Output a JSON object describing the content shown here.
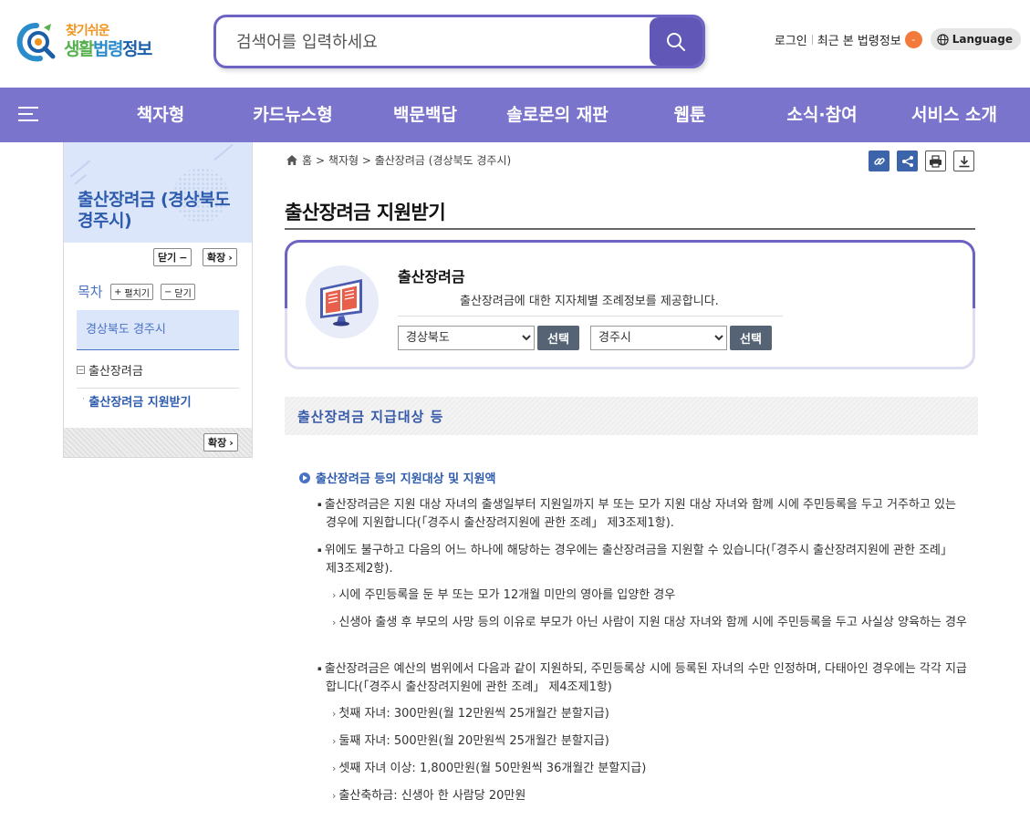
{
  "header": {
    "logo": {
      "top": "찾기쉬운",
      "main_g": "생활",
      "main_b": "법령",
      "main_d": "정보"
    },
    "search": {
      "placeholder": "검색어를 입력하세요"
    },
    "util": {
      "login": "로그인",
      "recent": "최근 본 법령정보",
      "recent_count": "-",
      "language": "Language"
    }
  },
  "nav": {
    "items": [
      "책자형",
      "카드뉴스형",
      "백문백답",
      "솔로몬의 재판",
      "웹툰",
      "소식·참여",
      "서비스 소개"
    ]
  },
  "sidebar": {
    "title": "출산장려금 (경상북도 경주시)",
    "close_label": "닫기",
    "expand_label": "확장",
    "toc_label": "목차",
    "toc_expand": "펼치기",
    "toc_close": "닫기",
    "region": "경상북도 경주시",
    "item": "출산장려금",
    "sub_item": "출산장려금 지원받기",
    "foot_expand": "확장"
  },
  "breadcrumb": {
    "home": "홈",
    "path": "> 책자형 > 출산장려금 (경상북도 경주시)"
  },
  "page": {
    "title": "출산장려금 지원받기"
  },
  "card": {
    "title": "출산장려금",
    "desc": "출산장려금에 대한 지자체별 조례정보를 제공합니다.",
    "select1": "경상북도",
    "select2": "경주시",
    "select_btn": "선택"
  },
  "content": {
    "section_title": "출산장려금 지급대상 등",
    "sub_heading": "출산장려금 등의 지원대상 및 지원액",
    "p1": "출산장려금은 지원 대상 자녀의 출생일부터 지원일까지 부 또는 모가 지원 대상 자녀와 함께 시에 주민등록을 두고 거주하고 있는 경우에 지원합니다(「경주시 출산장려지원에 관한 조례」 제3조제1항).",
    "p2": "위에도 불구하고 다음의 어느 하나에 해당하는 경우에는 출산장려금을 지원할 수 있습니다(「경주시 출산장려지원에 관한 조례」 제3조제2항).",
    "p2_items": [
      "시에 주민등록을 둔 부 또는 모가 12개월 미만의 영아를 입양한 경우",
      "신생아 출생 후 부모의 사망 등의 이유로 부모가 아닌 사람이 지원 대상 자녀와 함께 시에 주민등록을 두고 사실상 양육하는 경우"
    ],
    "p3": "출산장려금은 예산의 범위에서 다음과 같이 지원하되, 주민등록상 시에 등록된 자녀의 수만 인정하며, 다태아인 경우에는 각각 지급합니다(「경주시 출산장려지원에 관한 조례」 제4조제1항)",
    "p3_items": [
      "첫째 자녀: 300만원(월 12만원씩 25개월간 분할지급)",
      "둘째 자녀: 500만원(월 20만원씩 25개월간 분할지급)",
      "셋째 자녀 이상: 1,800만원(월 50만원씩 36개월간 분할지급)",
      "출산축하금: 신생아 한 사람당 20만원"
    ]
  }
}
